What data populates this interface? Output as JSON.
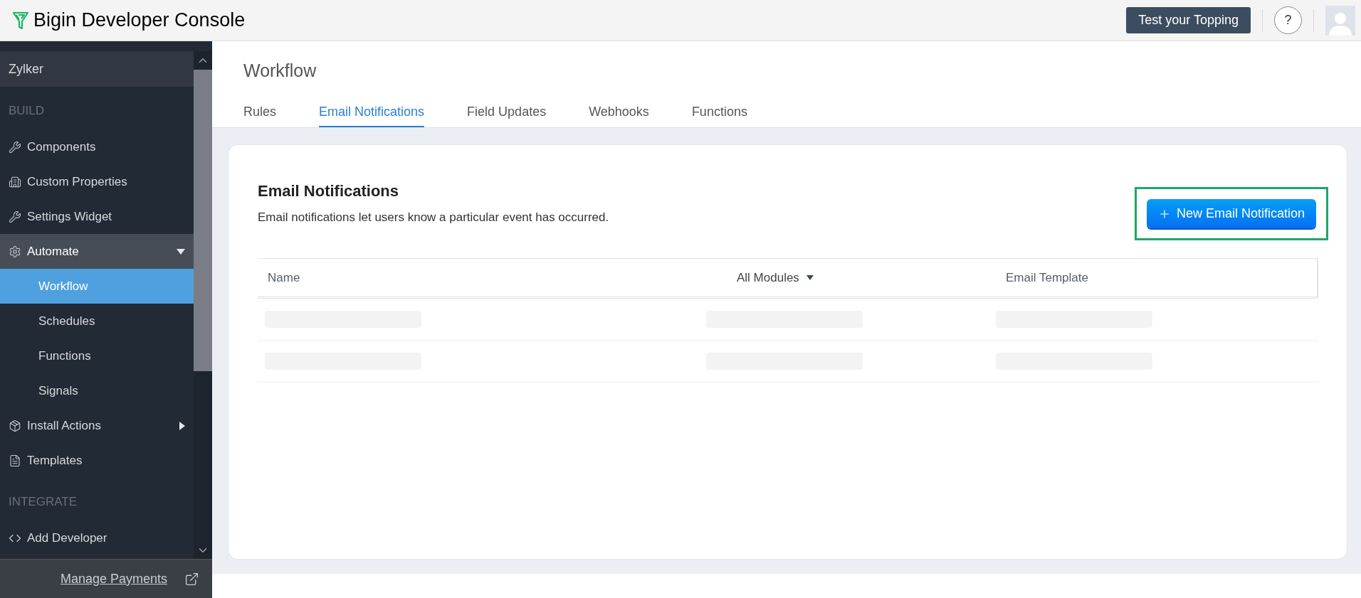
{
  "app_title": "Bigin Developer Console",
  "header_actions": {
    "test_button": "Test your Topping",
    "help": "?"
  },
  "sidebar": {
    "org": "Zylker",
    "items": [
      {
        "kind": "section",
        "label": "BUILD"
      },
      {
        "kind": "item",
        "label": "Components",
        "selected": false
      },
      {
        "kind": "item",
        "label": "Custom Properties",
        "selected": false
      },
      {
        "kind": "item",
        "label": "Settings Widget",
        "selected": false
      },
      {
        "kind": "group",
        "label": "Automate",
        "expanded": true,
        "children": [
          {
            "label": "Workflow",
            "selected": true
          },
          {
            "label": "Schedules",
            "selected": false
          },
          {
            "label": "Functions",
            "selected": false
          },
          {
            "label": "Signals",
            "selected": false
          }
        ]
      },
      {
        "kind": "group",
        "label": "Install Actions",
        "expanded": false
      },
      {
        "kind": "item",
        "label": "Templates",
        "selected": false
      },
      {
        "kind": "section",
        "label": "INTEGRATE"
      },
      {
        "kind": "item",
        "label": "Add Developer",
        "selected": false
      }
    ],
    "footer_link": "Manage Payments"
  },
  "page": {
    "title": "Workflow",
    "tabs": [
      {
        "label": "Rules",
        "selected": false
      },
      {
        "label": "Email Notifications",
        "selected": true
      },
      {
        "label": "Field Updates",
        "selected": false
      },
      {
        "label": "Webhooks",
        "selected": false
      },
      {
        "label": "Functions",
        "selected": false
      }
    ]
  },
  "card": {
    "title": "Email Notifications",
    "description": "Email notifications let users know a particular event has occurred.",
    "new_button": {
      "label": "New Email Notification",
      "highlighted": true
    },
    "table": {
      "columns": [
        {
          "label": "Name",
          "kind": "plain"
        },
        {
          "label": "All Modules",
          "kind": "filter"
        },
        {
          "label": "Email Template",
          "kind": "plain"
        }
      ],
      "rows": [
        {
          "kind": "loading"
        },
        {
          "kind": "loading"
        }
      ]
    }
  }
}
